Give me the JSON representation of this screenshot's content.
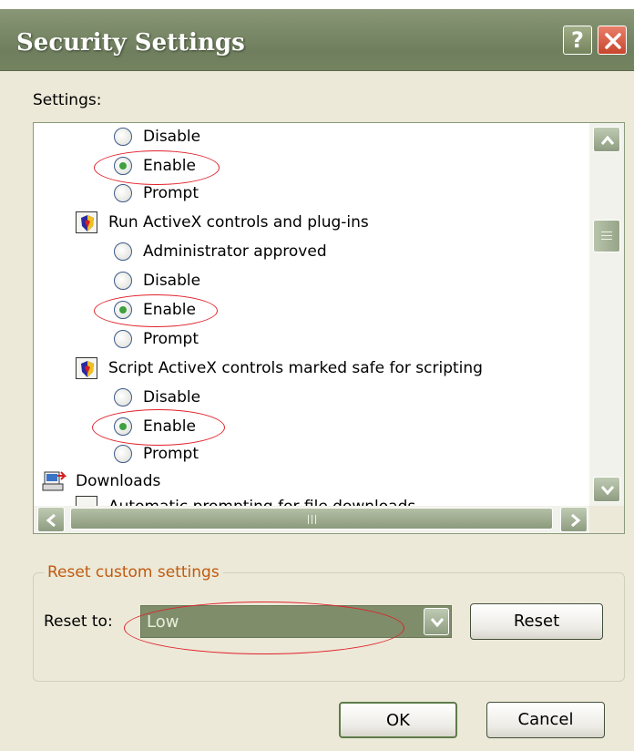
{
  "window": {
    "title": "Security Settings",
    "help_label": "?"
  },
  "settings": {
    "label": "Settings:",
    "rows": [
      {
        "kind": "radio",
        "label": "Disable",
        "checked": false
      },
      {
        "kind": "radio",
        "label": "Enable",
        "checked": true,
        "highlighted": true
      },
      {
        "kind": "radio",
        "label": "Prompt",
        "checked": false
      },
      {
        "kind": "category",
        "label": "Run ActiveX controls and plug-ins"
      },
      {
        "kind": "radio",
        "label": "Administrator approved",
        "checked": false
      },
      {
        "kind": "radio",
        "label": "Disable",
        "checked": false
      },
      {
        "kind": "radio",
        "label": "Enable",
        "checked": true,
        "highlighted": true
      },
      {
        "kind": "radio",
        "label": "Prompt",
        "checked": false
      },
      {
        "kind": "category",
        "label": "Script ActiveX controls marked safe for scripting"
      },
      {
        "kind": "radio",
        "label": "Disable",
        "checked": false
      },
      {
        "kind": "radio",
        "label": "Enable",
        "checked": true,
        "highlighted": true
      },
      {
        "kind": "radio",
        "label": "Prompt",
        "checked": false
      },
      {
        "kind": "section",
        "label": "Downloads"
      },
      {
        "kind": "category",
        "label": "Automatic prompting for file downloads"
      }
    ]
  },
  "reset_group": {
    "legend": "Reset custom settings",
    "reset_to_label": "Reset to:",
    "selected_level": "Low",
    "reset_button": "Reset"
  },
  "footer": {
    "ok_label": "OK",
    "cancel_label": "Cancel"
  },
  "colors": {
    "title_bar": "#7b8a68",
    "highlight_ellipse": "#e0202a",
    "group_legend": "#c05a10"
  }
}
